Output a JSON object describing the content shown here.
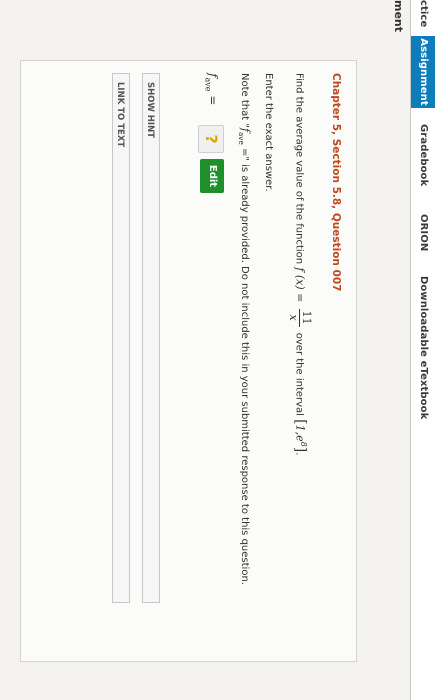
{
  "nav": {
    "tabs": [
      "ctice",
      "Assignment",
      "Gradebook",
      "ORION",
      "Downloadable eTextbook"
    ],
    "active_tab": "Assignment"
  },
  "section_title": "ment",
  "question": {
    "title": "Chapter 5, Section 5.8, Question 007",
    "prompt_start": "Find the average value of the function",
    "function_lhs": "f (x) =",
    "numerator": "11",
    "denominator": "x",
    "prompt_mid": "over the interval",
    "interval_start": "1,",
    "interval_end": "e",
    "interval_exp": "8",
    "instruction": "Enter the exact answer.",
    "note_start": "Note that \"",
    "note_symbol": "f",
    "note_sub": "ave",
    "note_end": " =\" is already provided. Do not include this in your submitted response to this question."
  },
  "answer": {
    "label": "f",
    "label_sub": "ave",
    "equals": "=",
    "placeholder_symbol": "?",
    "edit_label": "Edit"
  },
  "buttons": {
    "show_hint": "SHOW HINT",
    "link_to_text": "LINK TO TEXT"
  }
}
